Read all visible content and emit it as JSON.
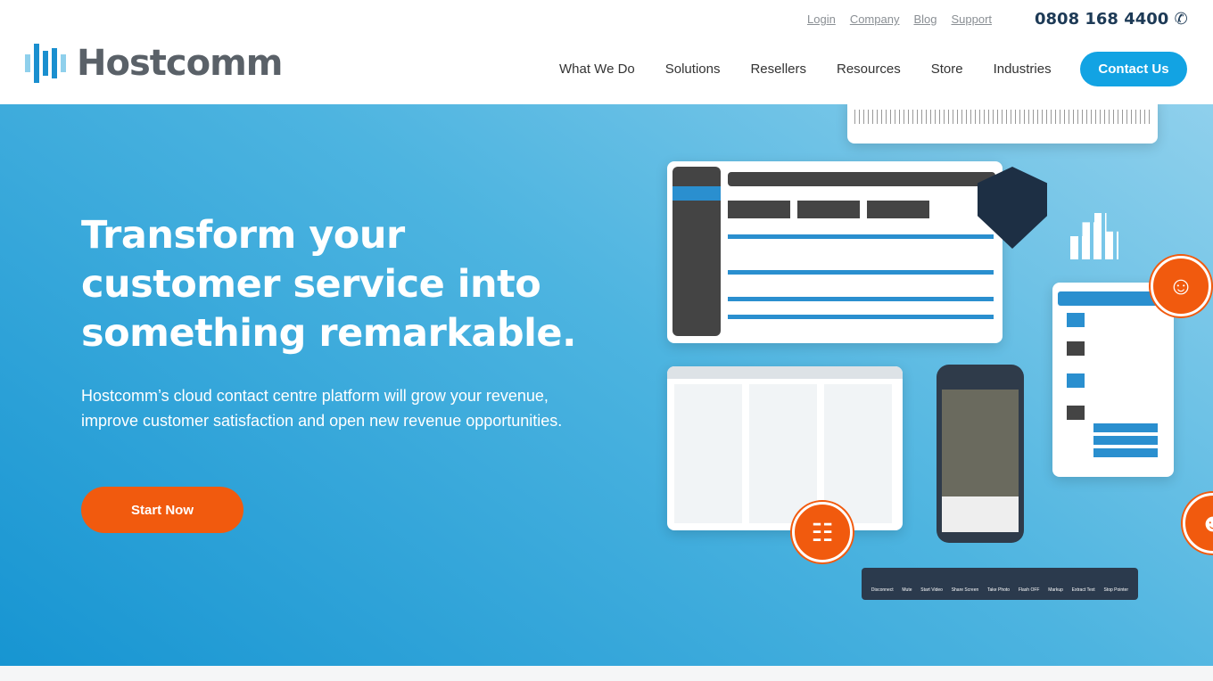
{
  "brand": {
    "name": "Hostcomm",
    "logo_color": "#1a8fcf"
  },
  "top_links": [
    "Login",
    "Company",
    "Blog",
    "Support"
  ],
  "phone": "0808 168 4400",
  "nav": [
    "What We Do",
    "Solutions",
    "Resellers",
    "Resources",
    "Store",
    "Industries"
  ],
  "cta": "Contact Us",
  "hero": {
    "title": "Transform your customer service into something remarkable.",
    "subtitle": "Hostcomm’s cloud contact centre platform will grow your revenue, improve customer satisfaction and open new revenue opportunities.",
    "button": "Start Now"
  },
  "toolbar": [
    "Disconnect",
    "Mute",
    "Start Video",
    "Share Screen",
    "Take Photo",
    "Flash OFF",
    "Markup",
    "Extract Text",
    "Stop Pointer"
  ],
  "colors": {
    "accent": "#12a3e3",
    "orange": "#f15a0e",
    "navy": "#1d3a56"
  }
}
